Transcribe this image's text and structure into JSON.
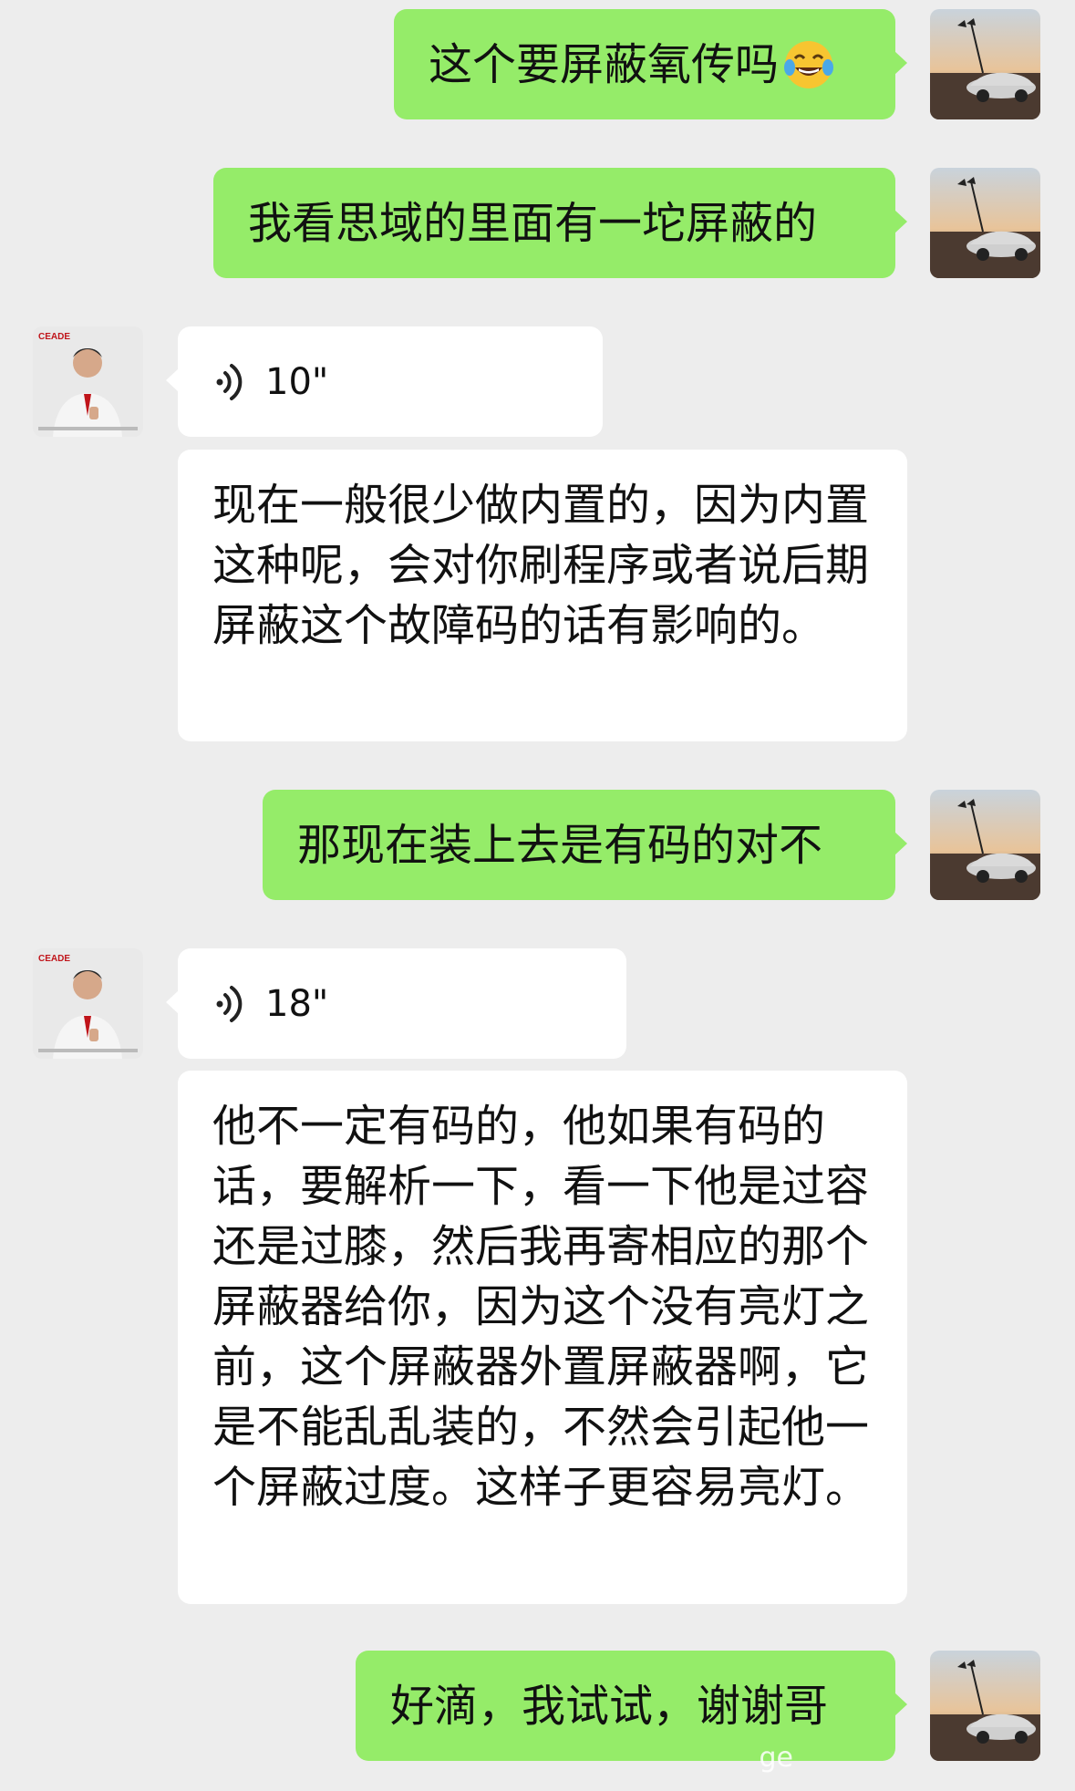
{
  "chat": {
    "messages": [
      {
        "from": "me",
        "type": "text",
        "text": "这个要屏蔽氧传吗",
        "emoji": "tears-of-joy"
      },
      {
        "from": "me",
        "type": "text",
        "text": "我看思域的里面有一坨屏蔽的"
      },
      {
        "from": "other",
        "type": "voice",
        "duration": "10\""
      },
      {
        "from": "other",
        "type": "text",
        "text": "现在一般很少做内置的，因为内置这种呢，会对你刷程序或者说后期屏蔽这个故障码的话有影响的。"
      },
      {
        "from": "me",
        "type": "text",
        "text": "那现在装上去是有码的对不"
      },
      {
        "from": "other",
        "type": "voice",
        "duration": "18\""
      },
      {
        "from": "other",
        "type": "text",
        "text": "他不一定有码的，他如果有码的话，要解析一下，看一下他是过容还是过膝，然后我再寄相应的那个屏蔽器给你，因为这个没有亮灯之前，这个屏蔽器外置屏蔽器啊，它是不能乱乱装的，不然会引起他一个屏蔽过度。这样子更容易亮灯。"
      },
      {
        "from": "me",
        "type": "text",
        "text": "好滴，我试试，谢谢哥"
      }
    ]
  },
  "avatars": {
    "other_logo": "CEADE"
  },
  "watermark": {
    "text": "ge"
  },
  "colors": {
    "background": "#ededed",
    "my_bubble": "#95ec69",
    "their_bubble": "#ffffff"
  }
}
